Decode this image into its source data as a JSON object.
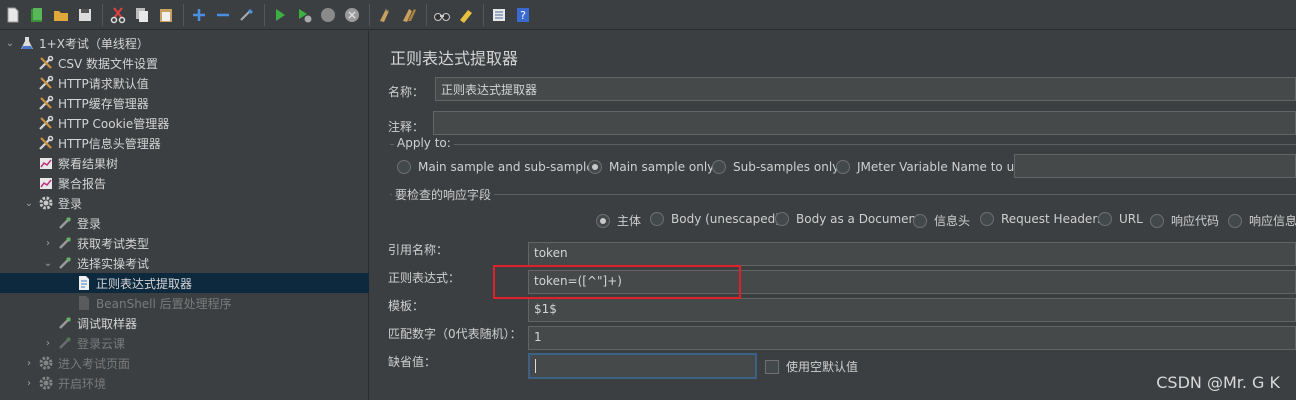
{
  "toolbar": {
    "buttons": [
      "new-icon",
      "templates-icon",
      "open-icon",
      "save-icon",
      "cut-icon",
      "copy-icon",
      "paste-icon",
      "expand-icon",
      "collapse-icon",
      "toggle-icon",
      "start-icon",
      "start-no-pause-icon",
      "stop-icon",
      "shutdown-icon",
      "clear-icon",
      "clear-all-icon",
      "search-icon",
      "reset-search-icon",
      "function-helper-icon",
      "help-icon"
    ]
  },
  "tree": {
    "items": [
      {
        "label": "1+X考试（单线程）",
        "icon": "test-plan-icon",
        "expanded": true
      },
      {
        "label": "CSV 数据文件设置",
        "icon": "config-icon"
      },
      {
        "label": "HTTP请求默认值",
        "icon": "config-icon"
      },
      {
        "label": "HTTP缓存管理器",
        "icon": "config-icon"
      },
      {
        "label": "HTTP Cookie管理器",
        "icon": "config-icon"
      },
      {
        "label": "HTTP信息头管理器",
        "icon": "config-icon"
      },
      {
        "label": "察看结果树",
        "icon": "listener-icon"
      },
      {
        "label": "聚合报告",
        "icon": "listener-icon"
      },
      {
        "label": "登录",
        "icon": "thread-group-icon",
        "expanded": true
      },
      {
        "label": "登录",
        "icon": "sampler-icon"
      },
      {
        "label": "获取考试类型",
        "icon": "sampler-icon",
        "collapsed": true
      },
      {
        "label": "选择实操考试",
        "icon": "sampler-icon",
        "expanded": true
      },
      {
        "label": "正则表达式提取器",
        "icon": "extractor-icon",
        "selected": true
      },
      {
        "label": "BeanShell 后置处理程序",
        "icon": "postprocessor-icon",
        "disabled": true
      },
      {
        "label": "调试取样器",
        "icon": "sampler-icon"
      },
      {
        "label": "登录云课",
        "icon": "sampler-icon",
        "disabled": true,
        "collapsed": true
      },
      {
        "label": "进入考试页面",
        "icon": "thread-group-icon",
        "disabled": true,
        "collapsed": true
      },
      {
        "label": "开启环境",
        "icon": "thread-group-icon",
        "disabled": true,
        "collapsed": true
      }
    ]
  },
  "panel": {
    "title": "正则表达式提取器",
    "name_label": "名称：",
    "name_value": "正则表达式提取器",
    "comment_label": "注释：",
    "comment_value": "",
    "apply_to": {
      "title": "Apply to:",
      "options": [
        "Main sample and sub-samples",
        "Main sample only",
        "Sub-samples only",
        "JMeter Variable Name to use"
      ],
      "selected": "Main sample only",
      "variable_value": ""
    },
    "field_to_check": {
      "title": "要检查的响应字段",
      "options": [
        "主体",
        "Body (unescaped)",
        "Body as a Document",
        "信息头",
        "Request Headers",
        "URL",
        "响应代码",
        "响应信息"
      ],
      "selected": "主体"
    },
    "ref_name_label": "引用名称：",
    "ref_name_value": "token",
    "regex_label": "正则表达式：",
    "regex_value": "token=([^\"]+)",
    "template_label": "模板：",
    "template_value": "$1$",
    "match_no_label": "匹配数字（0代表随机）：",
    "match_no_value": "1",
    "default_label": "缺省值：",
    "default_value": "",
    "use_empty_label": "使用空默认值",
    "use_empty_checked": false
  },
  "highlight_color": "#e0202a",
  "watermark": "CSDN @Mr. G K"
}
